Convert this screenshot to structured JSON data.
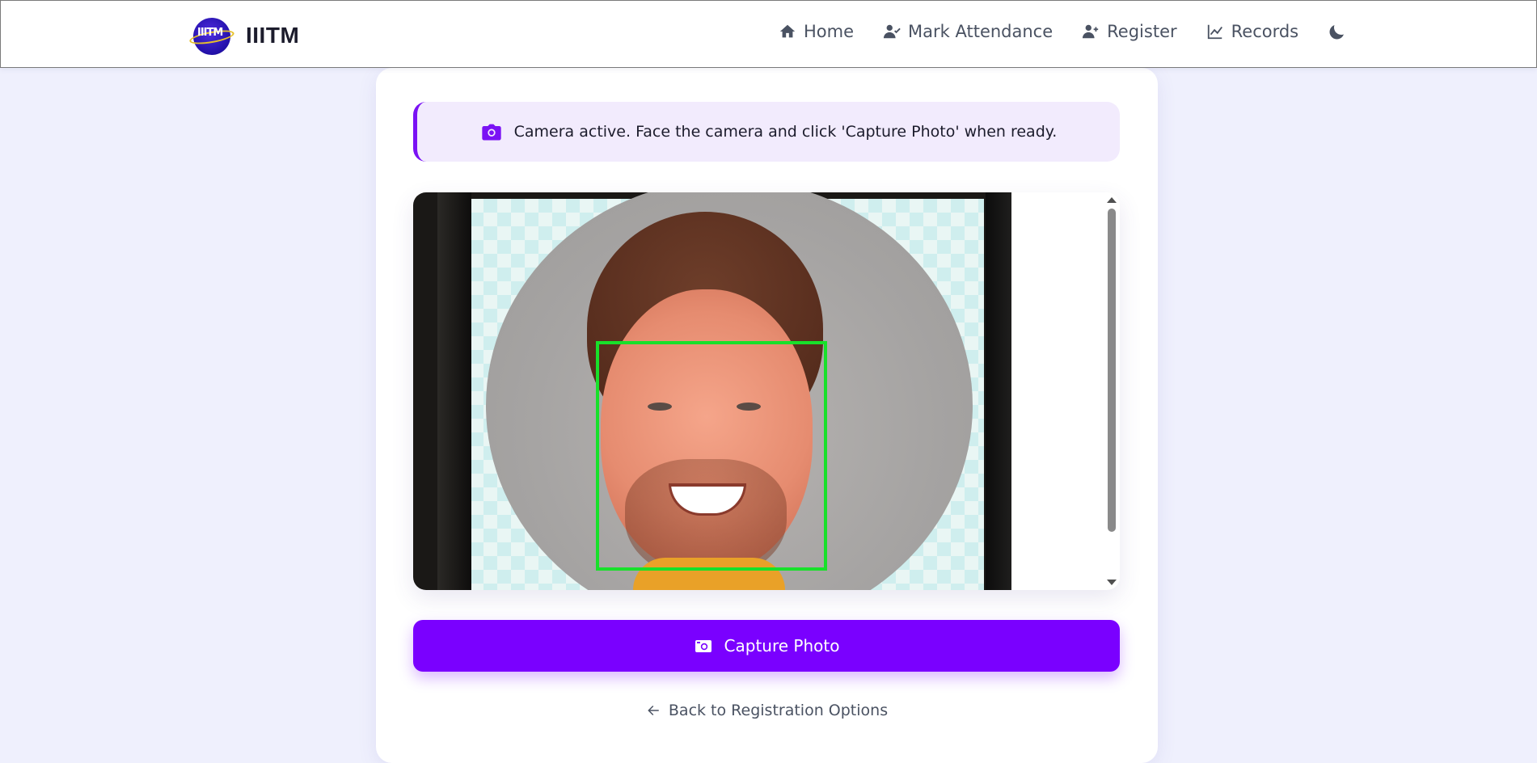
{
  "header": {
    "brand": "IIITM",
    "logo_text": "IIITM",
    "nav": [
      {
        "label": "Home",
        "icon": "home-icon"
      },
      {
        "label": "Mark Attendance",
        "icon": "user-check-icon"
      },
      {
        "label": "Register",
        "icon": "user-plus-icon"
      },
      {
        "label": "Records",
        "icon": "chart-line-icon"
      }
    ],
    "theme_icon": "moon-icon"
  },
  "alert": {
    "icon": "camera-icon",
    "text": "Camera active. Face the camera and click 'Capture Photo' when ready."
  },
  "camera": {
    "face_box_color": "#18e02a"
  },
  "actions": {
    "capture_label": "Capture Photo",
    "capture_icon": "camera-retro-icon",
    "back_label": "Back to Registration Options",
    "back_icon": "arrow-left-icon"
  },
  "colors": {
    "accent": "#7a00ff",
    "alert_bg": "#f2ebfd",
    "page_bg": "#eff0fd"
  }
}
